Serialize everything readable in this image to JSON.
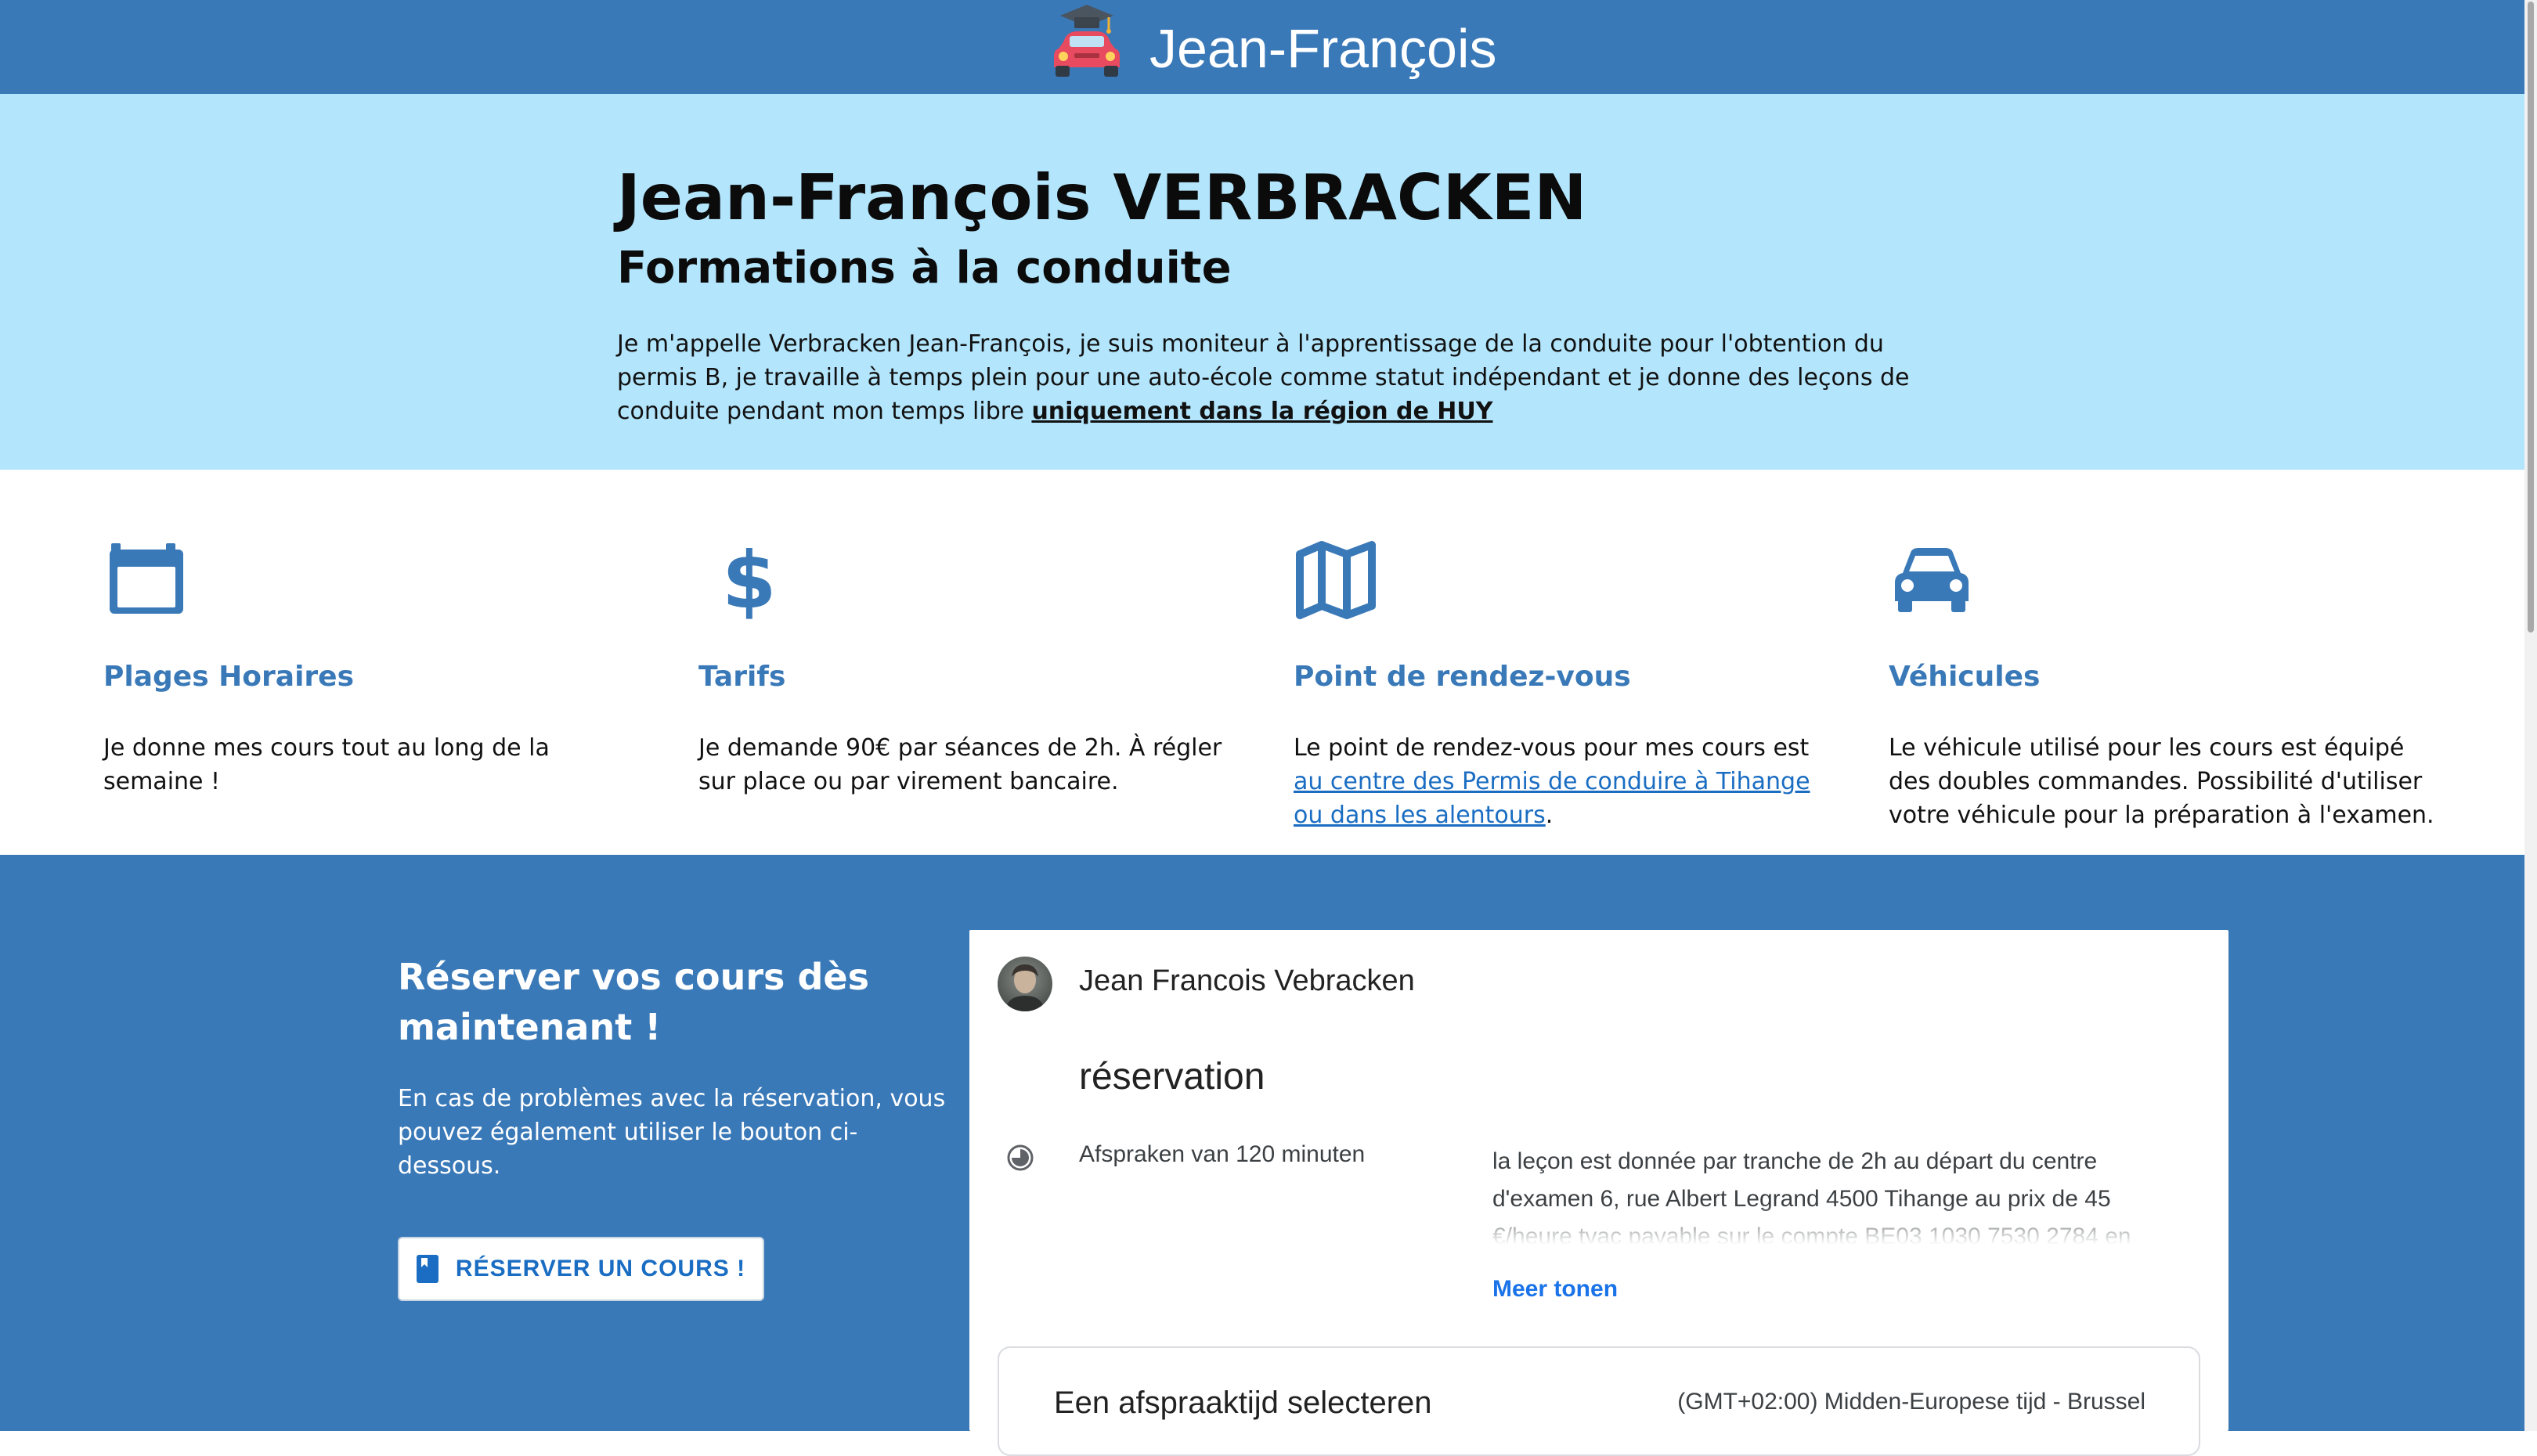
{
  "header": {
    "brand": "Jean-François",
    "logo_icon": "car-with-graduation-cap-icon"
  },
  "hero": {
    "title": "Jean-François VERBRACKEN",
    "subtitle": "Formations à la conduite",
    "intro_text": "Je m'appelle Verbracken Jean-François, je suis moniteur à l'apprentissage de la conduite pour l'obtention du permis B, je travaille à temps plein pour une auto-école comme statut indépendant et je donne des leçons de conduite pendant mon temps libre ",
    "region_link": "uniquement dans la région de HUY"
  },
  "features": [
    {
      "icon": "calendar-icon",
      "title": "Plages Horaires",
      "text": "Je donne mes cours tout au long de la semaine !"
    },
    {
      "icon": "dollar-icon",
      "title": "Tarifs",
      "text": "Je demande 90€ par séances de 2h. À régler sur place ou par virement bancaire."
    },
    {
      "icon": "map-icon",
      "title": "Point de rendez-vous",
      "text_before": "Le point de rendez-vous pour mes cours est ",
      "link": "au centre des Permis de conduire à Tihange ou dans les alentours",
      "text_after": "."
    },
    {
      "icon": "car-icon",
      "title": "Véhicules",
      "text": "Le véhicule utilisé pour les cours est équipé des doubles commandes. Possibilité d'utiliser votre véhicule pour la préparation à l'examen."
    }
  ],
  "booking": {
    "title": "Réserver vos cours dès maintenant !",
    "subtitle": "En cas de problèmes avec la réservation, vous pouvez également utiliser le bouton ci-dessous.",
    "button_label": "RÉSERVER UN COURS !",
    "button_icon": "book-icon"
  },
  "calendar_widget": {
    "owner_name": "Jean Francois Vebracken",
    "appointment_title": "réservation",
    "duration": "Afspraken van 120 minuten",
    "description": "la leçon est donnée par tranche de 2h au départ du centre d'examen 6, rue Albert Legrand 4500 Tihange au prix de 45 €/heure tvac payable sur le compte BE03 1030 7530 2784 en",
    "show_more": "Meer tonen",
    "select_time_title": "Een afspraaktijd selecteren",
    "timezone": "(GMT+02:00) Midden-Europese tijd - Brussel"
  },
  "colors": {
    "primary": "#3a79b8",
    "hero_bg": "#b3e5fc",
    "link": "#1a6dc2"
  }
}
